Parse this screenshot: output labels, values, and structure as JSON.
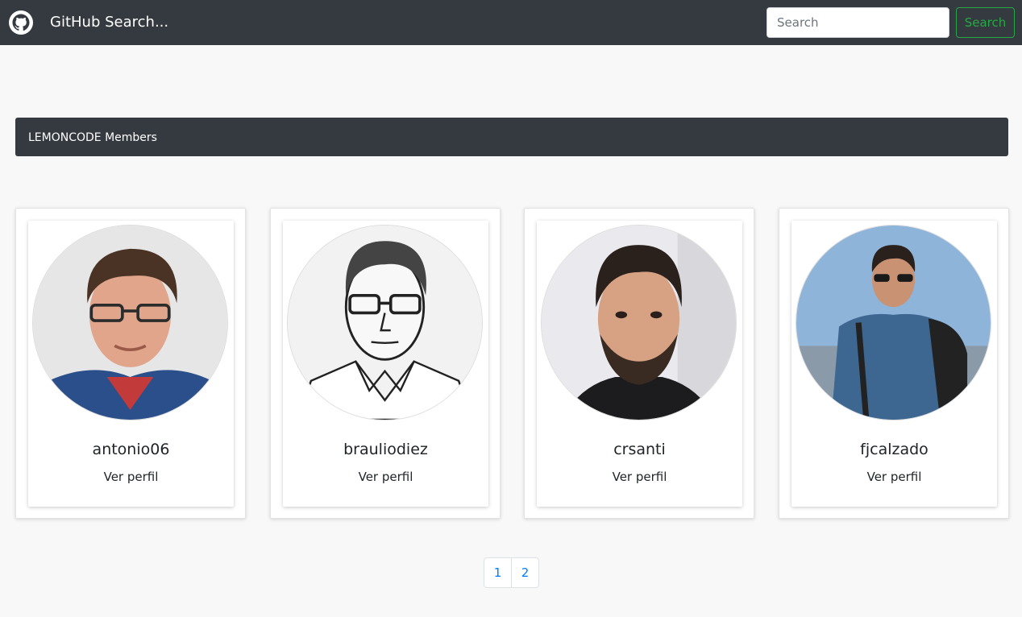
{
  "navbar": {
    "brand_icon": "github-icon",
    "title": "GitHub Search...",
    "search_placeholder": "Search",
    "search_value": "",
    "search_button": "Search",
    "colors": {
      "background": "#343a40",
      "button_accent": "#28a745"
    }
  },
  "section": {
    "title": "LEMONCODE Members"
  },
  "members": [
    {
      "login": "antonio06",
      "link_label": "Ver perfil"
    },
    {
      "login": "brauliodiez",
      "link_label": "Ver perfil"
    },
    {
      "login": "crsanti",
      "link_label": "Ver perfil"
    },
    {
      "login": "fjcalzado",
      "link_label": "Ver perfil"
    }
  ],
  "pagination": {
    "pages": [
      "1",
      "2"
    ],
    "link_color": "#007bff"
  }
}
